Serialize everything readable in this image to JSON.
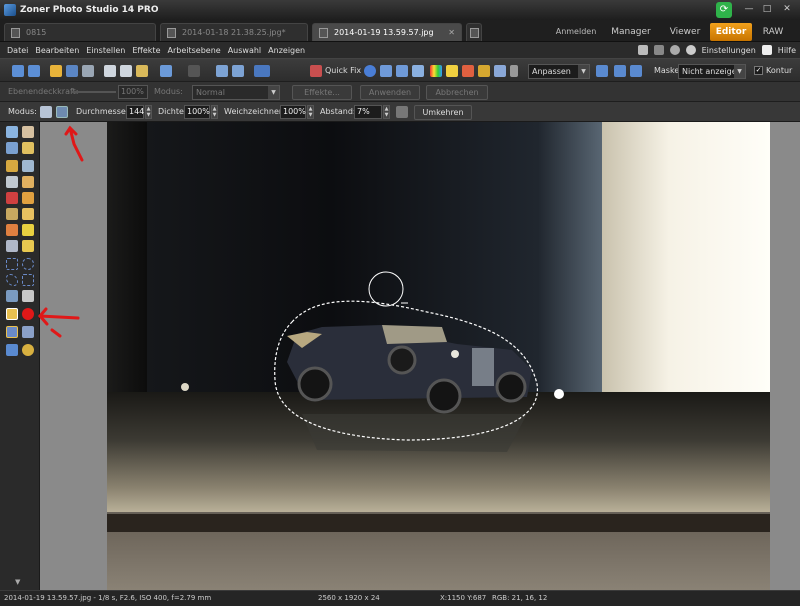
{
  "app": {
    "title": "Zoner Photo Studio 14 PRO"
  },
  "tabs": {
    "folder_tab": "0815",
    "doc_tabs": [
      {
        "label": "2014-01-18 21.38.25.jpg*",
        "active": false
      },
      {
        "label": "2014-01-19 13.59.57.jpg",
        "active": true
      }
    ],
    "modes": {
      "login": "Anmelden",
      "manager": "Manager",
      "viewer": "Viewer",
      "editor": "Editor",
      "raw": "RAW"
    }
  },
  "menu": {
    "items": [
      "Datei",
      "Bearbeiten",
      "Einstellen",
      "Effekte",
      "Arbeitsebene",
      "Auswahl",
      "Anzeigen"
    ],
    "settings_label": "Einstellungen",
    "help_label": "Hilfe"
  },
  "toolbar": {
    "quick_fix_label": "Quick Fix",
    "fit_dropdown": "Anpassen",
    "mask_label": "Maske:",
    "mask_value": "Nicht anzeigen",
    "contour_label": "Kontur",
    "contour_checked": true
  },
  "layer_toolbar": {
    "opacity_label": "Ebenendeckkraft:",
    "opacity_value": "100%",
    "mode_label": "Modus:",
    "mode_value": "Normal",
    "effects_label": "Effekte...",
    "apply_label": "Anwenden",
    "cancel_label": "Abbrechen"
  },
  "brush_toolbar": {
    "mode_label": "Modus:",
    "diameter_label": "Durchmesser:",
    "diameter_value": "144",
    "density_label": "Dichte:",
    "density_value": "100%",
    "softness_label": "Weichzeichnen:",
    "softness_value": "100%",
    "spacing_label": "Abstand:",
    "spacing_value": "7%",
    "invert_label": "Umkehren"
  },
  "statusbar": {
    "file_info": "2014-01-19 13.59.57.jpg - 1/8 s, F2.6, ISO 400, f=2.79 mm",
    "dimensions": "2560 x 1920 x 24",
    "coords": "X:1150 Y:687",
    "rgb": "RGB: 21, 16, 12"
  },
  "colors": {
    "editor_tab": "#e08a10",
    "annotation_red": "#e01818"
  }
}
